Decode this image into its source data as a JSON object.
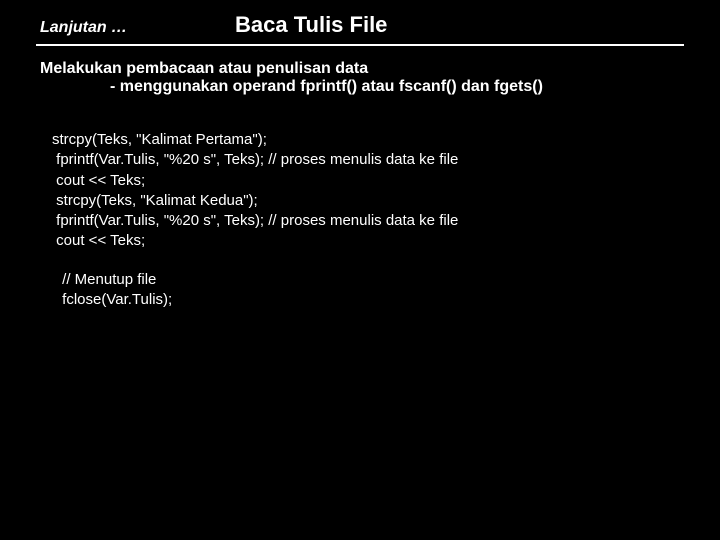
{
  "header": {
    "continued": "Lanjutan …",
    "title": "Baca Tulis File"
  },
  "desc": {
    "line1": "Melakukan pembacaan atau penulisan data",
    "line2_prefix": "- menggunakan operand ",
    "kw1": "fprintf()",
    "mid1": " atau ",
    "kw2": "fscanf()",
    "mid2": " dan ",
    "kw3": "fgets()"
  },
  "code": {
    "l1": "strcpy(Teks, \"Kalimat Pertama\");",
    "l2": " fprintf(Var.Tulis, \"%20 s\", Teks); // proses menulis data ke file",
    "l3": " cout << Teks;",
    "l4": " strcpy(Teks, \"Kalimat Kedua\");",
    "l5": " fprintf(Var.Tulis, \"%20 s\", Teks); // proses menulis data ke file",
    "l6": " cout << Teks;",
    "l7": " // Menutup file",
    "l8": " fclose(Var.Tulis);"
  }
}
